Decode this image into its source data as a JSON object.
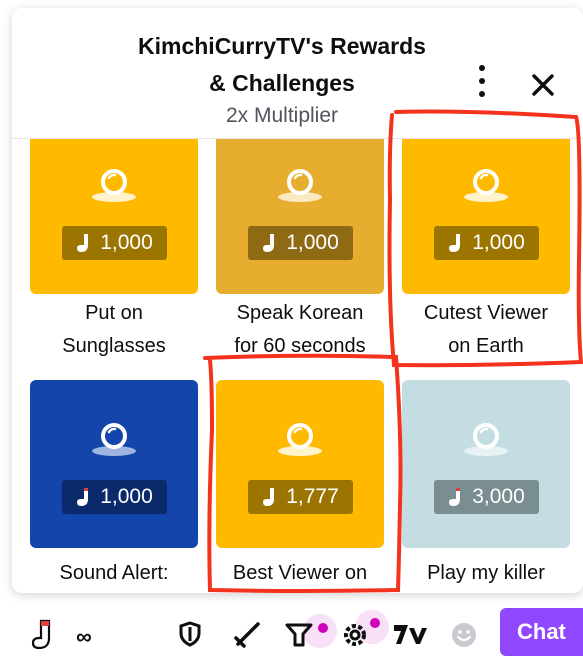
{
  "header": {
    "title_line1": "KimchiCurryTV's Rewards",
    "title_line2": "& Challenges",
    "subtitle": "2x Multiplier",
    "more_icon": "kebab-vertical-icon",
    "close_icon": "close-x-icon"
  },
  "rewards": [
    {
      "label_line1": "Put on",
      "label_line2": "Sunglasses",
      "cost": "1,000",
      "color": "#ffba00"
    },
    {
      "label_line1": "Speak Korean",
      "label_line2": "for 60 seconds",
      "cost": "1,000",
      "color": "#e6ad2e"
    },
    {
      "label_line1": "Cutest Viewer",
      "label_line2": "on Earth",
      "cost": "1,000",
      "color": "#ffba00"
    },
    {
      "label_line1": "Sound Alert:",
      "label_line2": "",
      "cost": "1,000",
      "color": "#1345aa"
    },
    {
      "label_line1": "Best Viewer on",
      "label_line2": "",
      "cost": "1,777",
      "color": "#ffba00"
    },
    {
      "label_line1": "Play my killer",
      "label_line2": "",
      "cost": "3,000",
      "color": "#c4dde2"
    }
  ],
  "bottom_bar": {
    "points_icon": "sock-points-icon",
    "points_value": "∞",
    "icons": [
      "shield-icon",
      "sword-icon",
      "megaphone-icon",
      "gear-icon",
      "7tv-icon",
      "emoji-icon"
    ],
    "chat_label": "Chat",
    "accent_color": "#9147ff",
    "notification_color": "#d000b8"
  }
}
